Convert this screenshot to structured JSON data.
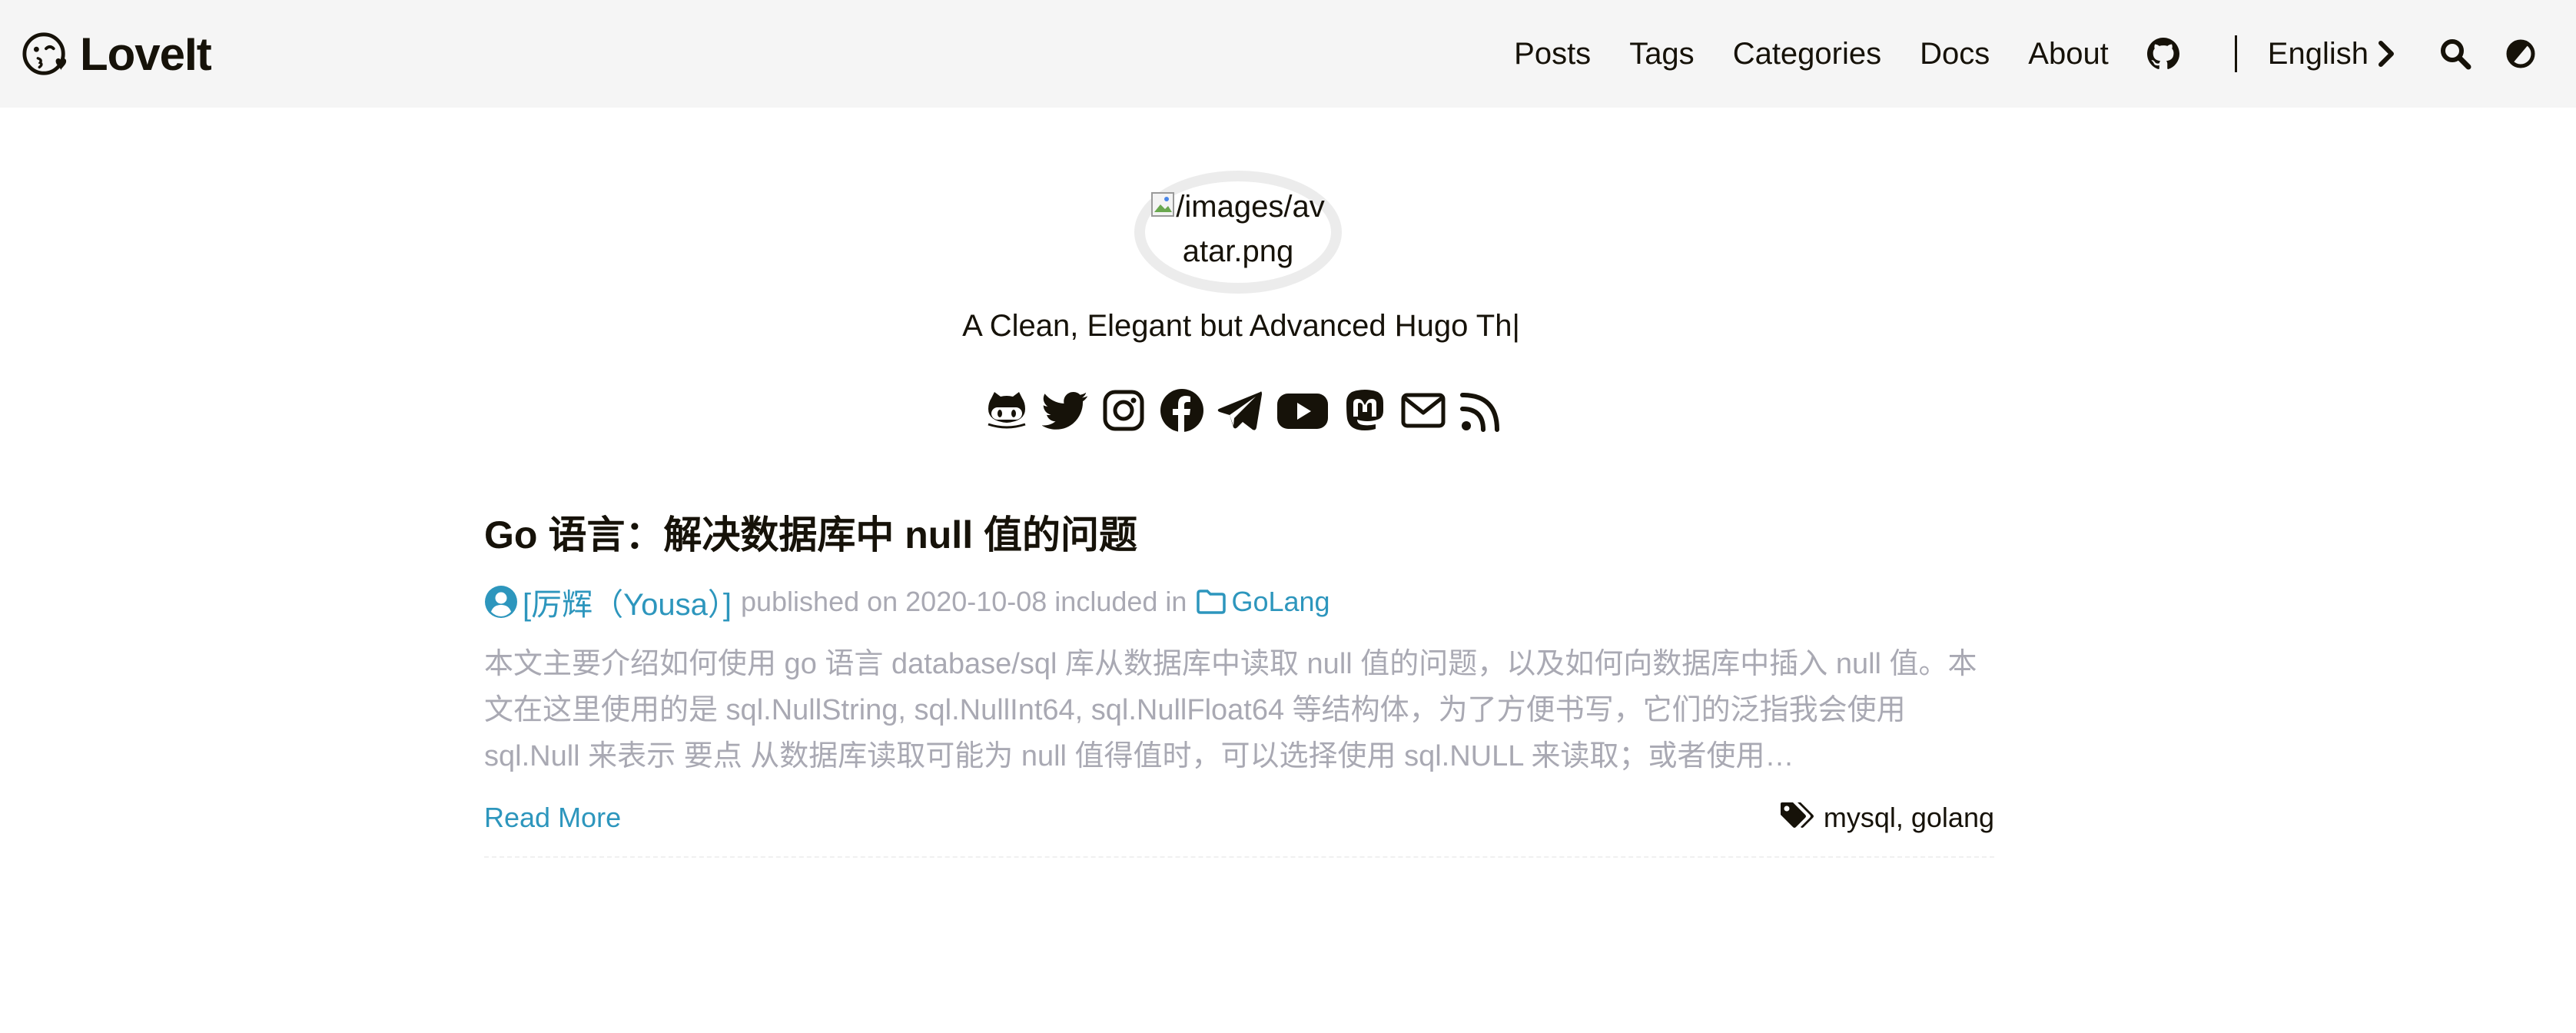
{
  "header": {
    "logo_text": "LoveIt",
    "menu": {
      "posts": "Posts",
      "tags": "Tags",
      "categories": "Categories",
      "docs": "Docs",
      "about": "About"
    },
    "language": "English",
    "icons": [
      "github-icon",
      "chevron-right-icon",
      "search-icon",
      "theme-switch-icon"
    ]
  },
  "profile": {
    "avatar_alt": "/images/avatar.png",
    "subtitle": "A Clean, Elegant but Advanced Hugo Th|",
    "social_icons": [
      "github-icon",
      "twitter-icon",
      "instagram-icon",
      "facebook-icon",
      "telegram-icon",
      "youtube-icon",
      "mastodon-icon",
      "email-icon",
      "rss-icon"
    ]
  },
  "post": {
    "title": "Go 语言：解决数据库中 null 值的问题",
    "author": "[厉辉（Yousa）]",
    "meta_published": "published on 2020-10-08 included in",
    "category": "GoLang",
    "summary": "本文主要介绍如何使用 go 语言 database/sql 库从数据库中读取 null 值的问题，以及如何向数据库中插入 null 值。本文在这里使用的是 sql.NullString, sql.NullInt64, sql.NullFloat64 等结构体，为了方便书写，它们的泛指我会使用 sql.Null 来表示 要点 从数据库读取可能为 null 值得值时，可以选择使用 sql.NULL 来读取；或者使用…",
    "read_more": "Read More",
    "tags": "mysql, golang"
  },
  "colors": {
    "link": "#2d96bd",
    "muted": "#a9a9b3",
    "header_bg": "#f5f5f5",
    "text": "#161209"
  }
}
